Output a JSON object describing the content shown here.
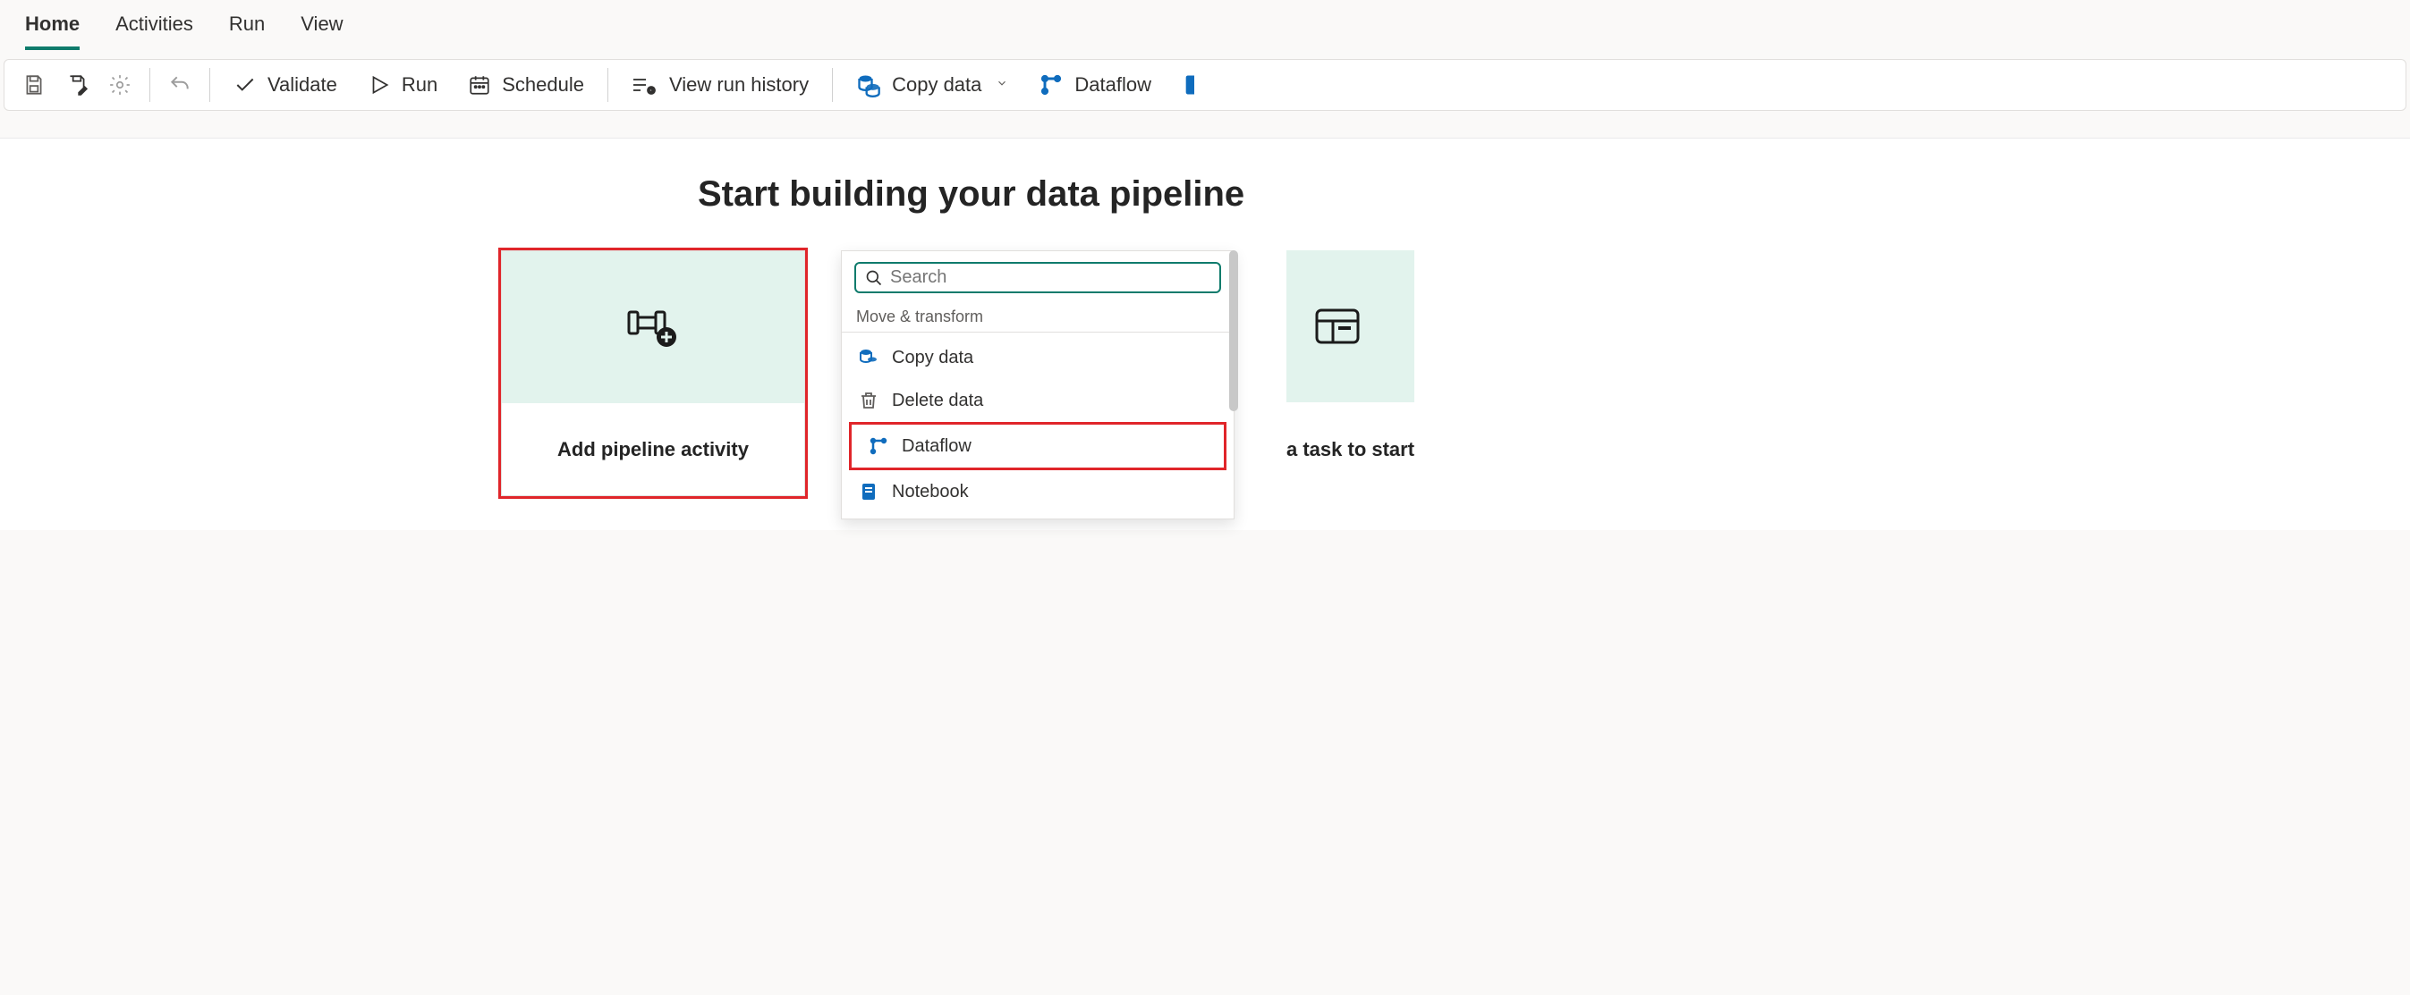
{
  "tabs": {
    "home": "Home",
    "activities": "Activities",
    "run": "Run",
    "view": "View"
  },
  "toolbar": {
    "validate": "Validate",
    "run": "Run",
    "schedule": "Schedule",
    "view_history": "View run history",
    "copy_data": "Copy data",
    "dataflow": "Dataflow"
  },
  "main": {
    "heading": "Start building your data pipeline"
  },
  "card": {
    "add_activity": "Add pipeline activity",
    "task_to_start": "a task to start"
  },
  "search": {
    "placeholder": "Search"
  },
  "dropdown": {
    "section": "Move & transform",
    "items": {
      "copy_data": "Copy data",
      "delete_data": "Delete data",
      "dataflow": "Dataflow",
      "notebook": "Notebook"
    }
  }
}
